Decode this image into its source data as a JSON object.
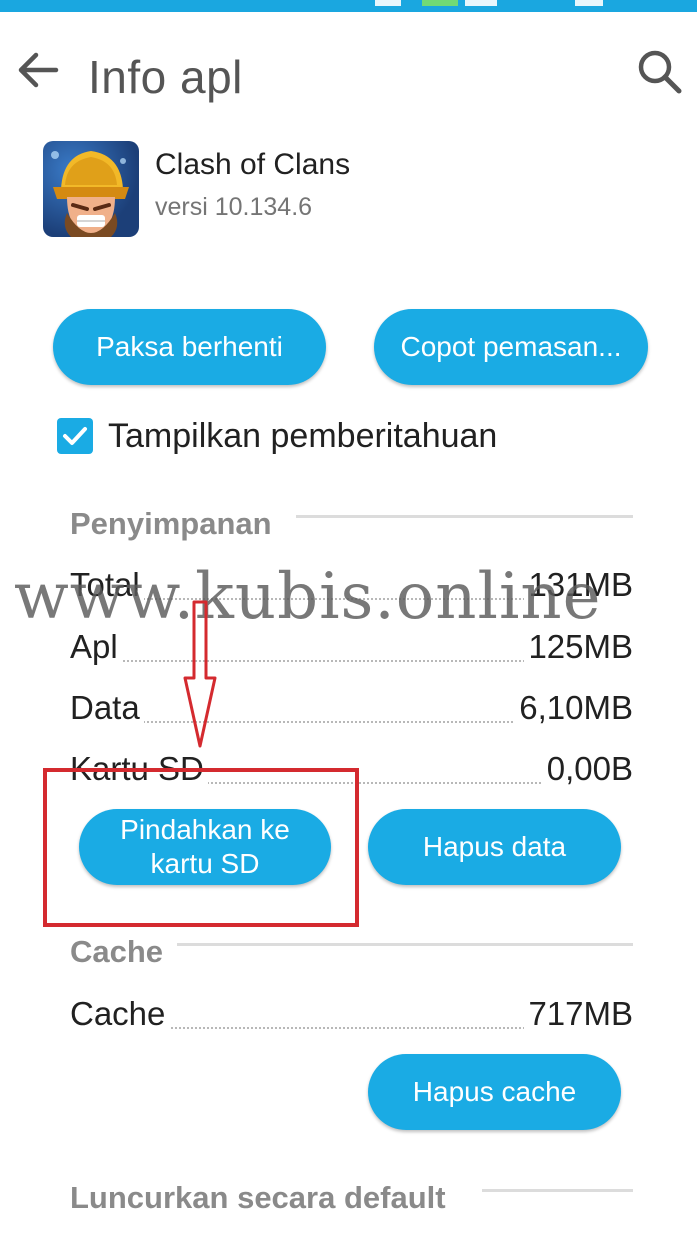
{
  "toolbar": {
    "title": "Info apl",
    "back_icon": "arrow-left-icon",
    "search_icon": "search-icon"
  },
  "app": {
    "name": "Clash of Clans",
    "version": "versi 10.134.6",
    "icon": "clash-of-clans-app-icon"
  },
  "actions": {
    "force_stop": "Paksa berhenti",
    "uninstall": "Copot pemasan..."
  },
  "notifications": {
    "label": "Tampilkan pemberitahuan",
    "checked": true
  },
  "storage": {
    "header": "Penyimpanan",
    "rows": [
      {
        "label": "Total",
        "value": "131MB"
      },
      {
        "label": "Apl",
        "value": "125MB"
      },
      {
        "label": "Data",
        "value": "6,10MB"
      },
      {
        "label": "Kartu SD",
        "value": "0,00B"
      }
    ],
    "move_to_sd": "Pindahkan ke kartu SD",
    "clear_data": "Hapus data"
  },
  "cache": {
    "header": "Cache",
    "row": {
      "label": "Cache",
      "value": "717MB"
    },
    "clear_cache": "Hapus cache"
  },
  "launch_default": {
    "header": "Luncurkan secara default"
  },
  "watermark": "www.kubis.online",
  "colors": {
    "accent": "#1aabe4",
    "statusbar": "#1aa7e0",
    "annotation_red": "#d42a2f"
  }
}
